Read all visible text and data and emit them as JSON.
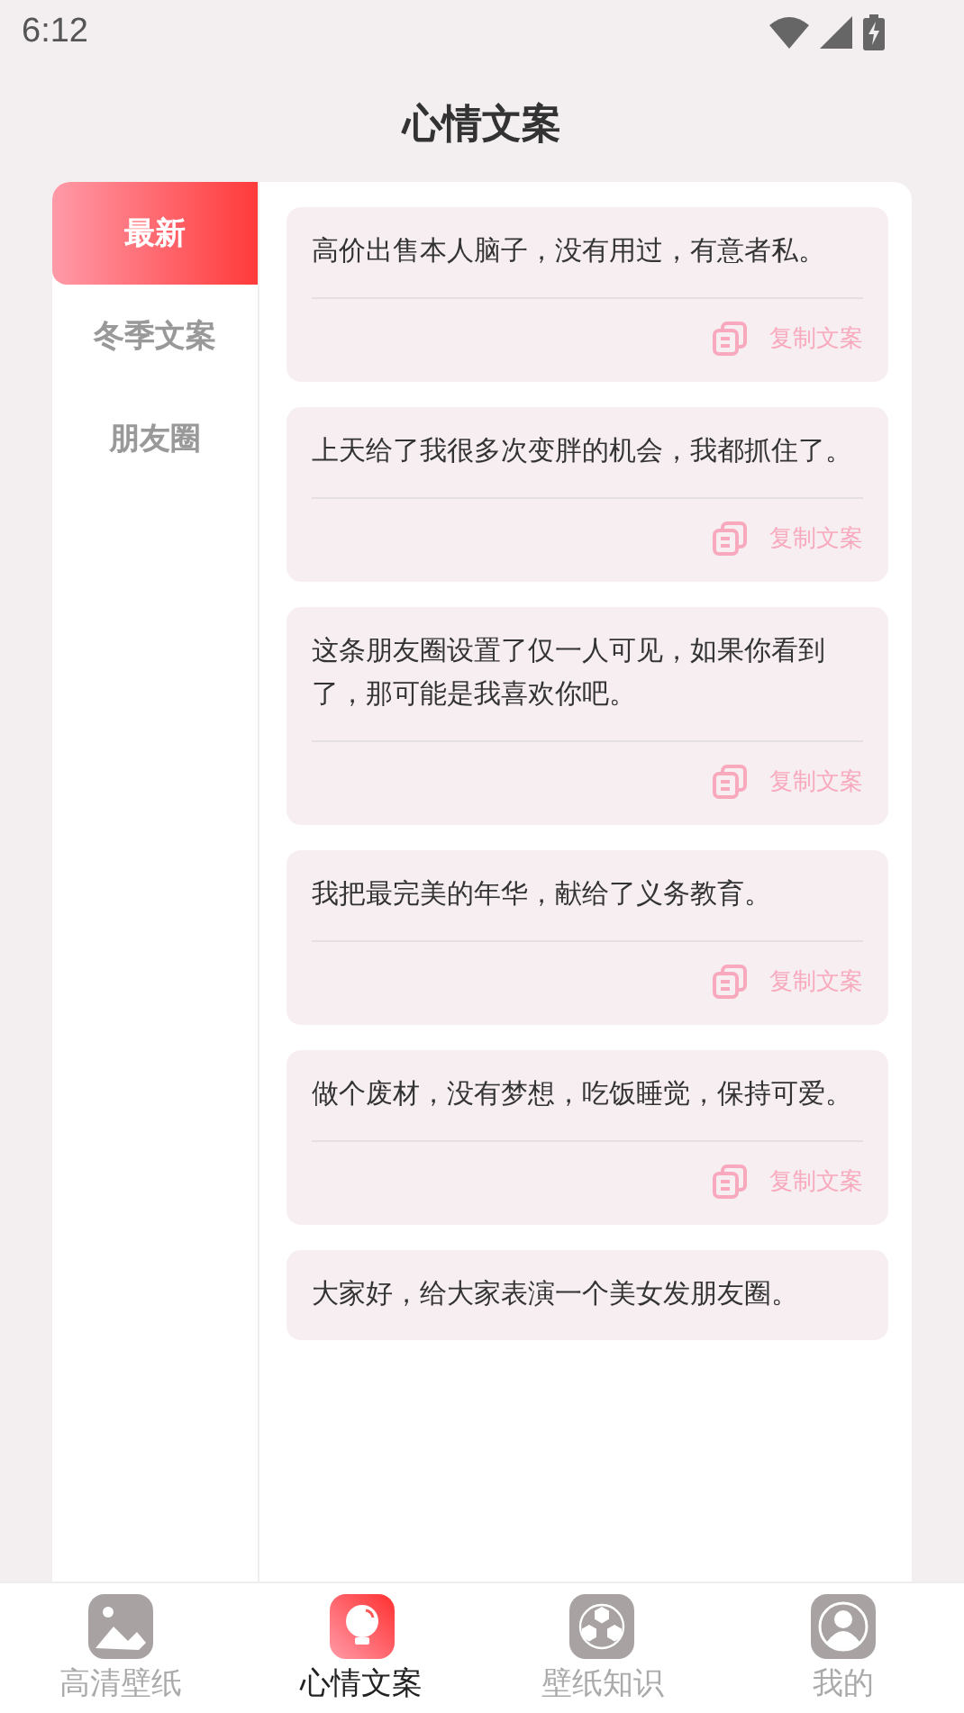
{
  "status_bar": {
    "time": "6:12"
  },
  "title": "心情文案",
  "categories": [
    {
      "label": "最新",
      "selected": true
    },
    {
      "label": "冬季文案",
      "selected": false
    },
    {
      "label": "朋友圈",
      "selected": false
    }
  ],
  "posts": [
    {
      "text": "高价出售本人脑子，没有用过，有意者私。",
      "action": "复制文案"
    },
    {
      "text": "上天给了我很多次变胖的机会，我都抓住了。",
      "action": "复制文案"
    },
    {
      "text": "这条朋友圈设置了仅一人可见，如果你看到了，那可能是我喜欢你吧。",
      "action": "复制文案"
    },
    {
      "text": "我把最完美的年华，献给了义务教育。",
      "action": "复制文案"
    },
    {
      "text": "做个废材，没有梦想，吃饭睡觉，保持可爱。",
      "action": "复制文案"
    },
    {
      "text": "大家好，给大家表演一个美女发朋友圈。"
    }
  ],
  "tab_bar": [
    {
      "label": "高清壁纸",
      "kind": "picture",
      "selected": false
    },
    {
      "label": "心情文案",
      "kind": "bulb",
      "selected": true
    },
    {
      "label": "壁纸知识",
      "kind": "hexagons",
      "selected": false
    },
    {
      "label": "我的",
      "kind": "person",
      "selected": false
    }
  ]
}
